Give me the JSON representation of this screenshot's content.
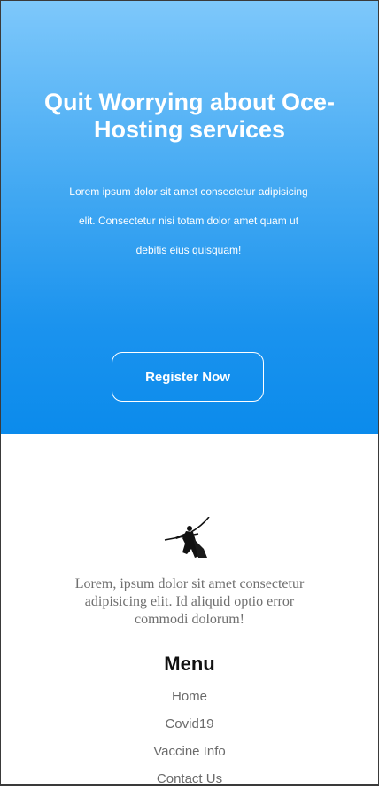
{
  "hero": {
    "title": "Quit Worrying about Oce-Hosting services",
    "text": "Lorem ipsum dolor sit amet consectetur adipisicing elit. Consectetur nisi totam dolor amet quam ut debitis eius quisquam!",
    "register_label": "Register Now",
    "gradient_top": "#7ec8fb",
    "gradient_bottom": "#0b8bec"
  },
  "footer": {
    "logo_icon": "archer-silhouette-icon",
    "text": "Lorem, ipsum dolor sit amet consectetur adipisicing elit. Id aliquid optio error commodi dolorum!",
    "menu": {
      "title": "Menu",
      "items": [
        {
          "label": "Home"
        },
        {
          "label": "Covid19"
        },
        {
          "label": "Vaccine Info"
        },
        {
          "label": "Contact Us"
        }
      ]
    }
  }
}
